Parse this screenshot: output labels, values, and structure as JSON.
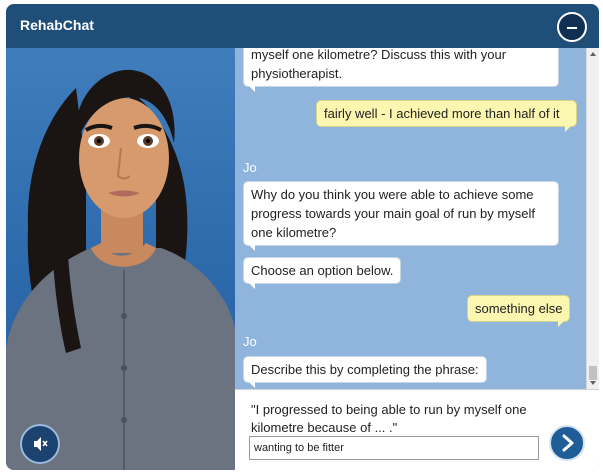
{
  "app": {
    "title": "RehabChat"
  },
  "chat": {
    "messages": [
      {
        "type": "bot",
        "text": "myself one kilometre? Discuss this with your physiotherapist."
      },
      {
        "type": "user",
        "text": "fairly well - I achieved more than half of it"
      },
      {
        "type": "sender",
        "text": "Jo"
      },
      {
        "type": "bot",
        "text": "Why do you think you were able to achieve some progress towards your main goal of run by myself one kilometre?"
      },
      {
        "type": "bot",
        "text": "Choose an option below."
      },
      {
        "type": "user",
        "text": "something else"
      },
      {
        "type": "sender",
        "text": "Jo"
      },
      {
        "type": "bot",
        "text": "Describe this by completing the phrase:"
      }
    ]
  },
  "compose": {
    "prompt": "\"I progressed to being able to run by myself one kilometre because of ... .\"",
    "input_value": "wanting to be fitter"
  },
  "icons": {
    "minimize": "minus-icon",
    "mute": "speaker-muted-icon",
    "send": "chevron-right-icon"
  },
  "colors": {
    "titlebar": "#1f4e79",
    "chat_background": "#8fb5dc",
    "user_bubble": "#fbf7b0",
    "bot_bubble": "#ffffff",
    "send_button": "#1f5d99"
  }
}
